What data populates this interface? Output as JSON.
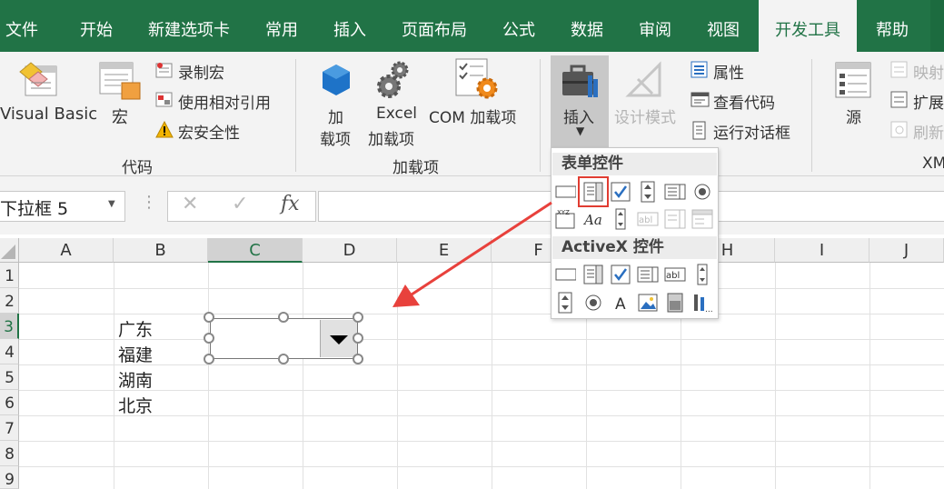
{
  "tabs": [
    {
      "label": "文件",
      "active": false
    },
    {
      "label": "开始",
      "active": false
    },
    {
      "label": "新建选项卡",
      "active": false
    },
    {
      "label": "常用",
      "active": false
    },
    {
      "label": "插入",
      "active": false
    },
    {
      "label": "页面布局",
      "active": false
    },
    {
      "label": "公式",
      "active": false
    },
    {
      "label": "数据",
      "active": false
    },
    {
      "label": "审阅",
      "active": false
    },
    {
      "label": "视图",
      "active": false
    },
    {
      "label": "开发工具",
      "active": true
    },
    {
      "label": "帮助",
      "active": false
    }
  ],
  "ribbon": {
    "code": {
      "visual_basic": "Visual Basic",
      "macro": "宏",
      "record_macro": "录制宏",
      "relative_ref": "使用相对引用",
      "macro_security": "宏安全性",
      "group_label": "代码"
    },
    "addins": {
      "addin": "加\n载项",
      "addin_l1": "加",
      "addin_l2": "载项",
      "excel_addin_l1": "Excel",
      "excel_addin_l2": "加载项",
      "com_addin": "COM 加载项",
      "group_label": "加载项"
    },
    "controls": {
      "insert": "插入",
      "design_mode": "设计模式",
      "properties": "属性",
      "view_code": "查看代码",
      "run_dialog": "运行对话框"
    },
    "xml": {
      "source": "源",
      "map_props": "映射",
      "expansion": "扩展",
      "refresh": "刷新",
      "group_label": "XM"
    }
  },
  "formula_bar": {
    "name_box": "下拉框 5",
    "fx": "fx",
    "formula": ""
  },
  "grid": {
    "columns": [
      "A",
      "B",
      "C",
      "D",
      "E",
      "F",
      "G",
      "H",
      "I",
      "J"
    ],
    "selected_column": "C",
    "rows": [
      "1",
      "2",
      "3",
      "4",
      "5",
      "6",
      "7",
      "8",
      "9"
    ],
    "selected_row": "3",
    "cells_b": [
      "广东",
      "福建",
      "湖南",
      "北京"
    ]
  },
  "insert_panel": {
    "form_controls_title": "表单控件",
    "activex_title": "ActiveX 控件",
    "form_controls": [
      "button",
      "combo-box",
      "check-box",
      "spin-button",
      "list-box",
      "option-button",
      "group-box",
      "label",
      "scroll-bar",
      "text-field",
      "combo-list-edit",
      "combo-drop-down-edit"
    ],
    "activex_controls": [
      "command-button",
      "combo-box",
      "check-box",
      "list-box",
      "text-box",
      "scroll-bar",
      "spin-button",
      "option-button",
      "label",
      "image",
      "toggle-button",
      "more-controls"
    ],
    "highlighted": "combo-box"
  },
  "colors": {
    "brand": "#217346",
    "highlight": "#e03c31",
    "arrow": "#e8413c"
  }
}
